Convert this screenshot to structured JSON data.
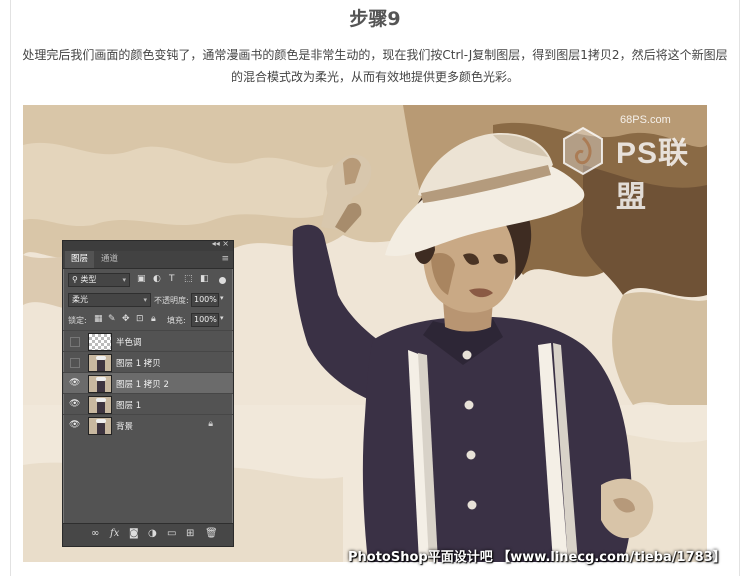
{
  "article": {
    "step_title": "步骤9",
    "paragraph": "处理完后我们画面的颜色变钝了，通常漫画书的颜色是非常生动的，现在我们按Ctrl-J复制图层，得到图层1拷贝2，然后将这个新图层的混合模式改为柔光，从而有效地提供更多颜色光彩。"
  },
  "watermark": {
    "site": "68PS.com",
    "brand": "PS联盟",
    "credit": "PhotoShop平面设计吧 【www.linecg.com/tieba/1783】"
  },
  "layers_panel": {
    "tabs": [
      "图层",
      "通道"
    ],
    "filter_label": "类型",
    "blend_mode": "柔光",
    "opacity_label": "不透明度:",
    "opacity_value": "100%",
    "lock_label": "锁定:",
    "fill_label": "填充:",
    "fill_value": "100%",
    "layers": [
      {
        "name": "半色调",
        "visible": false,
        "selected": false,
        "locked": false,
        "thumb": "halftone"
      },
      {
        "name": "图层 1 拷贝",
        "visible": false,
        "selected": false,
        "locked": false,
        "thumb": "photo"
      },
      {
        "name": "图层 1 拷贝 2",
        "visible": true,
        "selected": true,
        "locked": false,
        "thumb": "photo"
      },
      {
        "name": "图层 1",
        "visible": true,
        "selected": false,
        "locked": false,
        "thumb": "photo"
      },
      {
        "name": "背景",
        "visible": true,
        "selected": false,
        "locked": true,
        "thumb": "photo"
      }
    ],
    "bottom_icons": [
      "link-icon",
      "fx-icon",
      "mask-icon",
      "adjustment-icon",
      "group-icon",
      "new-layer-icon",
      "trash-icon"
    ]
  },
  "colors": {
    "photo_bg": "#efe5d6",
    "sepia_dark": "#8a6a45",
    "sepia_mid": "#b89a74",
    "shirt": "#3a3145",
    "panel_bg": "#535353",
    "panel_selected": "#6b6b6b"
  }
}
